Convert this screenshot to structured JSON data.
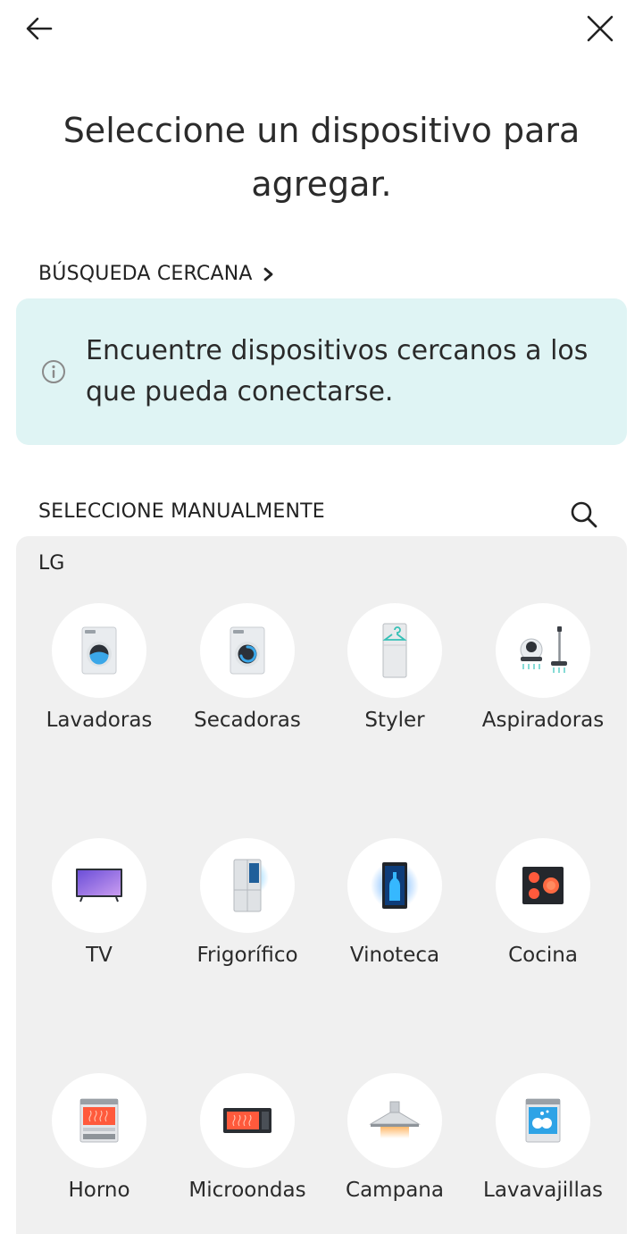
{
  "header": {
    "back_icon": "arrow-left-icon",
    "close_icon": "close-icon"
  },
  "title": "Seleccione un dispositivo para agregar.",
  "nearby": {
    "heading": "BÚSQUEDA CERCANA",
    "chevron_icon": "chevron-right-icon",
    "info_icon": "info-icon",
    "info_text": "Encuentre dispositivos cercanos a los que pueda conectarse."
  },
  "manual": {
    "heading": "SELECCIONE MANUALMENTE",
    "search_icon": "search-icon",
    "brand": "LG",
    "devices": [
      {
        "label": "Lavadoras",
        "icon": "washer-icon"
      },
      {
        "label": "Secadoras",
        "icon": "dryer-icon"
      },
      {
        "label": "Styler",
        "icon": "styler-icon"
      },
      {
        "label": "Aspiradoras",
        "icon": "vacuum-icon"
      },
      {
        "label": "TV",
        "icon": "tv-icon"
      },
      {
        "label": "Frigorífico",
        "icon": "refrigerator-icon"
      },
      {
        "label": "Vinoteca",
        "icon": "wine-cellar-icon"
      },
      {
        "label": "Cocina",
        "icon": "cooktop-icon"
      },
      {
        "label": "Horno",
        "icon": "oven-icon"
      },
      {
        "label": "Microondas",
        "icon": "microwave-icon"
      },
      {
        "label": "Campana",
        "icon": "range-hood-icon"
      },
      {
        "label": "Lavavajillas",
        "icon": "dishwasher-icon"
      }
    ]
  },
  "colors": {
    "info_card_bg": "#dff4f4",
    "panel_bg": "#f0f0f0",
    "text": "#262626"
  }
}
